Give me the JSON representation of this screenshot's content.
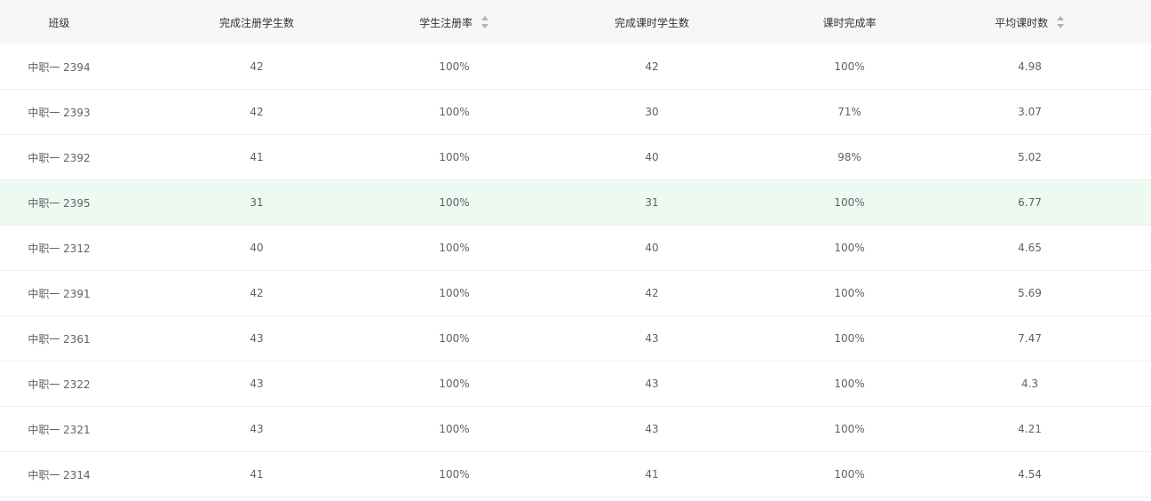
{
  "table": {
    "headers": [
      {
        "label": "班级",
        "sortable": false
      },
      {
        "label": "完成注册学生数",
        "sortable": false
      },
      {
        "label": "学生注册率",
        "sortable": true
      },
      {
        "label": "完成课时学生数",
        "sortable": false
      },
      {
        "label": "课时完成率",
        "sortable": false
      },
      {
        "label": "平均课时数",
        "sortable": true
      }
    ],
    "highlight_color": "#ecfaf2",
    "rows": [
      {
        "class": "中职一 2394",
        "registered": "42",
        "reg_rate": "100%",
        "completed": "42",
        "completion_rate": "100%",
        "avg_hours": "4.98"
      },
      {
        "class": "中职一 2393",
        "registered": "42",
        "reg_rate": "100%",
        "completed": "30",
        "completion_rate": "71%",
        "avg_hours": "3.07"
      },
      {
        "class": "中职一 2392",
        "registered": "41",
        "reg_rate": "100%",
        "completed": "40",
        "completion_rate": "98%",
        "avg_hours": "5.02"
      },
      {
        "class": "中职一 2395",
        "registered": "31",
        "reg_rate": "100%",
        "completed": "31",
        "completion_rate": "100%",
        "avg_hours": "6.77",
        "highlighted": true
      },
      {
        "class": "中职一 2312",
        "registered": "40",
        "reg_rate": "100%",
        "completed": "40",
        "completion_rate": "100%",
        "avg_hours": "4.65"
      },
      {
        "class": "中职一 2391",
        "registered": "42",
        "reg_rate": "100%",
        "completed": "42",
        "completion_rate": "100%",
        "avg_hours": "5.69"
      },
      {
        "class": "中职一 2361",
        "registered": "43",
        "reg_rate": "100%",
        "completed": "43",
        "completion_rate": "100%",
        "avg_hours": "7.47"
      },
      {
        "class": "中职一 2322",
        "registered": "43",
        "reg_rate": "100%",
        "completed": "43",
        "completion_rate": "100%",
        "avg_hours": "4.3"
      },
      {
        "class": "中职一 2321",
        "registered": "43",
        "reg_rate": "100%",
        "completed": "43",
        "completion_rate": "100%",
        "avg_hours": "4.21"
      },
      {
        "class": "中职一 2314",
        "registered": "41",
        "reg_rate": "100%",
        "completed": "41",
        "completion_rate": "100%",
        "avg_hours": "4.54"
      }
    ]
  }
}
